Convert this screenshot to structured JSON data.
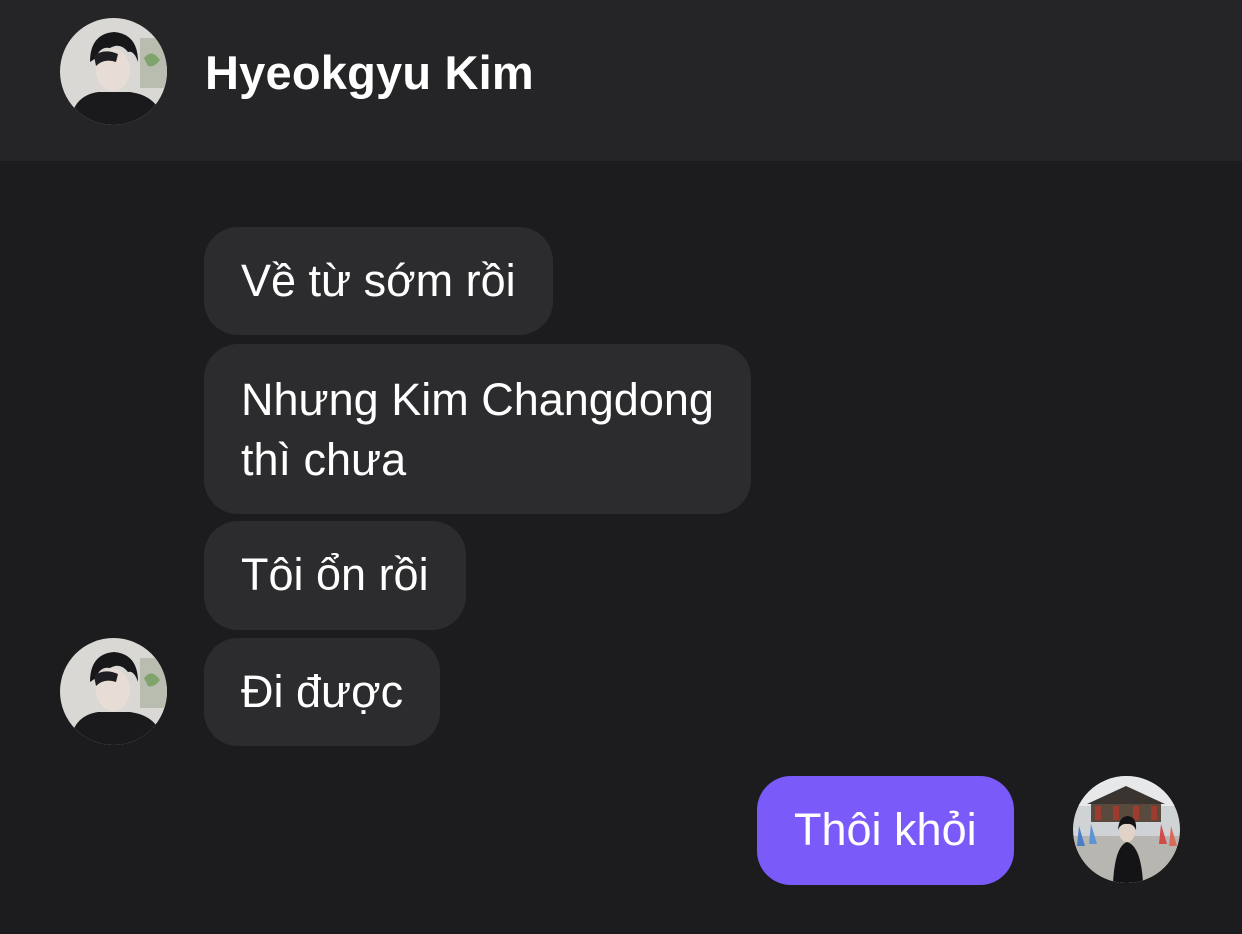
{
  "header": {
    "contact_name": "Hyeokgyu Kim",
    "avatar_icon": "contact-avatar"
  },
  "messages": [
    {
      "direction": "incoming",
      "text": "Về từ sớm rồi"
    },
    {
      "direction": "incoming",
      "lines": [
        "Nhưng Kim Changdong",
        "thì chưa"
      ]
    },
    {
      "direction": "incoming",
      "text": "Tôi ổn rồi"
    },
    {
      "direction": "incoming",
      "text": "Đi được",
      "show_avatar": true
    },
    {
      "direction": "outgoing",
      "text": "Thôi khỏi",
      "show_avatar": true
    }
  ],
  "colors": {
    "background": "#1c1c1e",
    "header": "#252527",
    "incoming_bubble": "#2c2c2e",
    "outgoing_bubble": "#7a5af8",
    "text": "#ffffff"
  }
}
